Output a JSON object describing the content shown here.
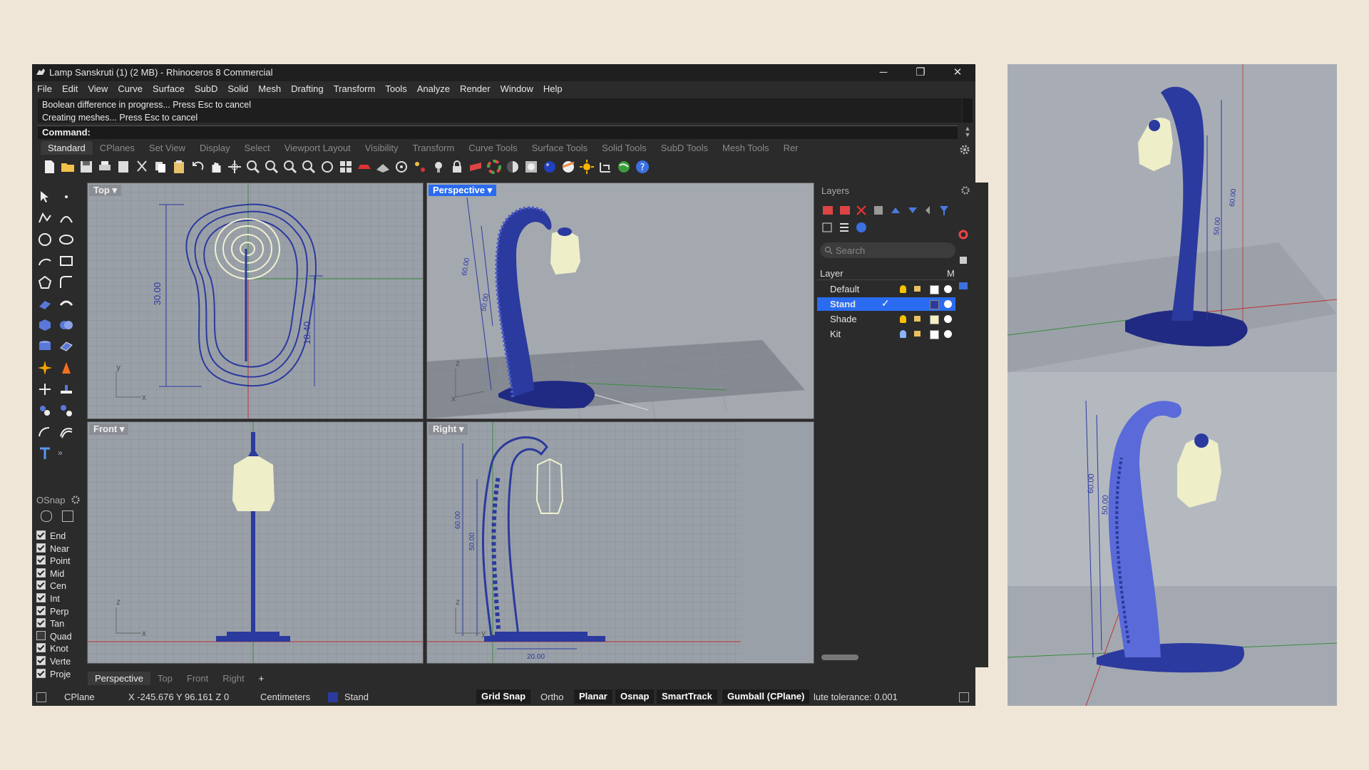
{
  "window": {
    "title": "Lamp Sanskruti (1) (2 MB) - Rhinoceros 8 Commercial",
    "controls": [
      "─",
      "❐",
      "✕"
    ]
  },
  "menu": [
    "File",
    "Edit",
    "View",
    "Curve",
    "Surface",
    "SubD",
    "Solid",
    "Mesh",
    "Drafting",
    "Transform",
    "Tools",
    "Analyze",
    "Render",
    "Window",
    "Help"
  ],
  "history": {
    "line1": "Boolean difference in progress... Press Esc to cancel",
    "line2": "Creating meshes... Press Esc to cancel"
  },
  "command": {
    "label": "Command:"
  },
  "toolbar_tabs": [
    "Standard",
    "CPlanes",
    "Set View",
    "Display",
    "Select",
    "Viewport Layout",
    "Visibility",
    "Transform",
    "Curve Tools",
    "Surface Tools",
    "Solid Tools",
    "SubD Tools",
    "Mesh Tools",
    "Rer"
  ],
  "viewports": {
    "top": {
      "label": "Top",
      "dims": [
        "30.00",
        "18.40"
      ],
      "axes": [
        "y",
        "x"
      ]
    },
    "perspective": {
      "label": "Perspective",
      "dims": [
        "60.00",
        "50.00"
      ],
      "axes": [
        "z",
        "x"
      ]
    },
    "front": {
      "label": "Front",
      "axes": [
        "z",
        "x"
      ]
    },
    "right": {
      "label": "Right",
      "dims": [
        "60.00",
        "50.00",
        "20.00"
      ],
      "axes": [
        "z",
        "y"
      ]
    }
  },
  "osnap": {
    "title": "OSnap",
    "items": [
      {
        "label": "End",
        "checked": true
      },
      {
        "label": "Near",
        "checked": true
      },
      {
        "label": "Point",
        "checked": true
      },
      {
        "label": "Mid",
        "checked": true
      },
      {
        "label": "Cen",
        "checked": true
      },
      {
        "label": "Int",
        "checked": true
      },
      {
        "label": "Perp",
        "checked": true
      },
      {
        "label": "Tan",
        "checked": true
      },
      {
        "label": "Quad",
        "checked": false
      },
      {
        "label": "Knot",
        "checked": true
      },
      {
        "label": "Verte",
        "checked": true
      },
      {
        "label": "Proje",
        "checked": true
      }
    ]
  },
  "layers": {
    "title": "Layers",
    "search_placeholder": "Search",
    "col_layer": "Layer",
    "col_m": "M",
    "rows": [
      {
        "name": "Default",
        "selected": false,
        "color": "#ffffff"
      },
      {
        "name": "Stand",
        "selected": true,
        "color": "#2b3a9e"
      },
      {
        "name": "Shade",
        "selected": false,
        "color": "#f4f0c0"
      },
      {
        "name": "Kit",
        "selected": false,
        "color": "#ffffff"
      }
    ]
  },
  "viewport_tabs": [
    "Perspective",
    "Top",
    "Front",
    "Right",
    "+"
  ],
  "status": {
    "cplane": "CPlane",
    "coords": "X -245.676 Y 96.161 Z 0",
    "units": "Centimeters",
    "layer": "Stand",
    "grid_snap": "Grid Snap",
    "ortho": "Ortho",
    "planar": "Planar",
    "osnap": "Osnap",
    "smarttrack": "SmartTrack",
    "gumball": "Gumball (CPlane)",
    "tolerance": "lute tolerance: 0.001"
  },
  "renders": {
    "top_dims": [
      "60.00",
      "50.00"
    ],
    "bottom_dims": [
      "60.00",
      "50.00"
    ]
  },
  "colors": {
    "stand": "#2b3a9e",
    "shade": "#eeeec8",
    "accent": "#2a6bf0"
  }
}
